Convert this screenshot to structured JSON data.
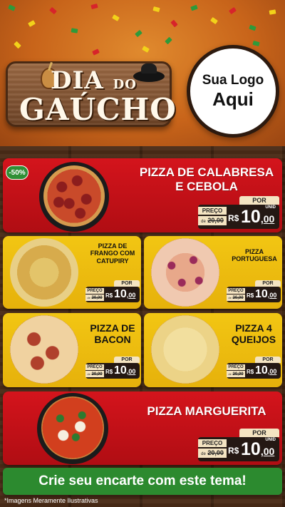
{
  "header": {
    "title_line1": "DIA",
    "title_connector": "DO",
    "title_line2": "GAÚCHO",
    "logo_line1": "Sua Logo",
    "logo_line2": "Aqui"
  },
  "colors": {
    "red": "#c8111a",
    "yellow": "#f0c012",
    "green": "#2c8a2f",
    "wood": "#4a2b17"
  },
  "pricing": {
    "por_label": "POR",
    "preco_label": "PREÇO",
    "de_prefix": "de",
    "old_price": "20,00",
    "currency": "R$",
    "price_int": "10",
    "price_dec": "00",
    "unit": "UNID"
  },
  "products": [
    {
      "name_line1": "PIZZA DE CALABRESA",
      "name_line2": "E CEBOLA",
      "badge": "-50%"
    },
    {
      "name_line1": "PIZZA DE",
      "name_line2": "FRANGO COM",
      "name_line3": "CATUPIRY"
    },
    {
      "name_line1": "PIZZA",
      "name_line2": "PORTUGUESA"
    },
    {
      "name_line1": "PIZZA DE",
      "name_line2": "BACON"
    },
    {
      "name_line1": "PIZZA 4",
      "name_line2": "QUEIJOS"
    },
    {
      "name_line1": "PIZZA MARGUERITA"
    }
  ],
  "cta": "Crie seu encarte com este tema!",
  "disclaimer": "*Imagens Meramente Ilustrativas"
}
